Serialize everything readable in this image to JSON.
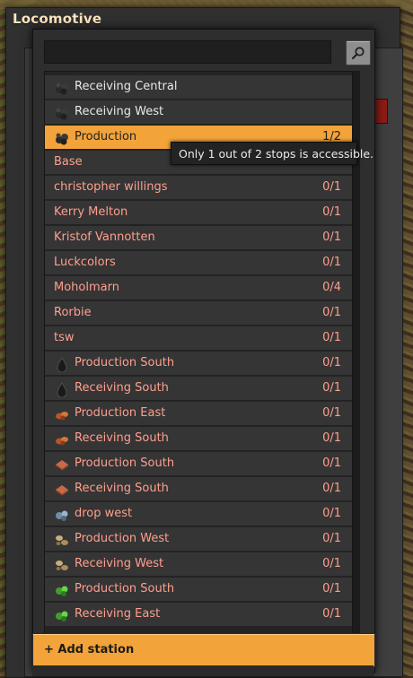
{
  "window": {
    "title": "Locomotive"
  },
  "search": {
    "placeholder": ""
  },
  "stations": [
    {
      "name": "Receiving Central",
      "count": "",
      "accessible": true,
      "icon": "coal-icon"
    },
    {
      "name": "Receiving West",
      "count": "",
      "accessible": true,
      "icon": "coal-icon"
    },
    {
      "name": "Production",
      "count": "1/2",
      "accessible": true,
      "icon": "coal-icon",
      "selected": true
    },
    {
      "name": "Base",
      "count": "",
      "accessible": false,
      "icon": ""
    },
    {
      "name": "christopher willings",
      "count": "0/1",
      "accessible": false,
      "icon": ""
    },
    {
      "name": "Kerry Melton",
      "count": "0/1",
      "accessible": false,
      "icon": ""
    },
    {
      "name": "Kristof Vannotten",
      "count": "0/1",
      "accessible": false,
      "icon": ""
    },
    {
      "name": "Luckcolors",
      "count": "0/1",
      "accessible": false,
      "icon": ""
    },
    {
      "name": "Moholmarn",
      "count": "0/4",
      "accessible": false,
      "icon": ""
    },
    {
      "name": "Rorbie",
      "count": "0/1",
      "accessible": false,
      "icon": ""
    },
    {
      "name": "tsw",
      "count": "0/1",
      "accessible": false,
      "icon": ""
    },
    {
      "name": "Production South",
      "count": "0/1",
      "accessible": false,
      "icon": "crude-oil-icon"
    },
    {
      "name": "Receiving South",
      "count": "0/1",
      "accessible": false,
      "icon": "crude-oil-icon"
    },
    {
      "name": "Production East",
      "count": "0/1",
      "accessible": false,
      "icon": "copper-ore-icon"
    },
    {
      "name": "Receiving South",
      "count": "0/1",
      "accessible": false,
      "icon": "copper-ore-icon"
    },
    {
      "name": "Production South",
      "count": "0/1",
      "accessible": false,
      "icon": "copper-plate-icon"
    },
    {
      "name": "Receiving South",
      "count": "0/1",
      "accessible": false,
      "icon": "copper-plate-icon"
    },
    {
      "name": "drop west",
      "count": "0/1",
      "accessible": false,
      "icon": "iron-ore-icon"
    },
    {
      "name": "Production West",
      "count": "0/1",
      "accessible": false,
      "icon": "stone-icon"
    },
    {
      "name": "Receiving West",
      "count": "0/1",
      "accessible": false,
      "icon": "stone-icon"
    },
    {
      "name": "Production South",
      "count": "0/1",
      "accessible": false,
      "icon": "uranium-ore-icon"
    },
    {
      "name": "Receiving East",
      "count": "0/1",
      "accessible": false,
      "icon": "uranium-ore-icon"
    }
  ],
  "tooltip": {
    "text": "Only 1 out of 2 stops is accessible."
  },
  "add_station": {
    "label": "+ Add station"
  },
  "colors": {
    "selected_row": "#f2a33a",
    "inaccessible_text": "#ff9f8e",
    "accessible_text": "#e8e8e8",
    "add_bar": "#f2a33a"
  }
}
